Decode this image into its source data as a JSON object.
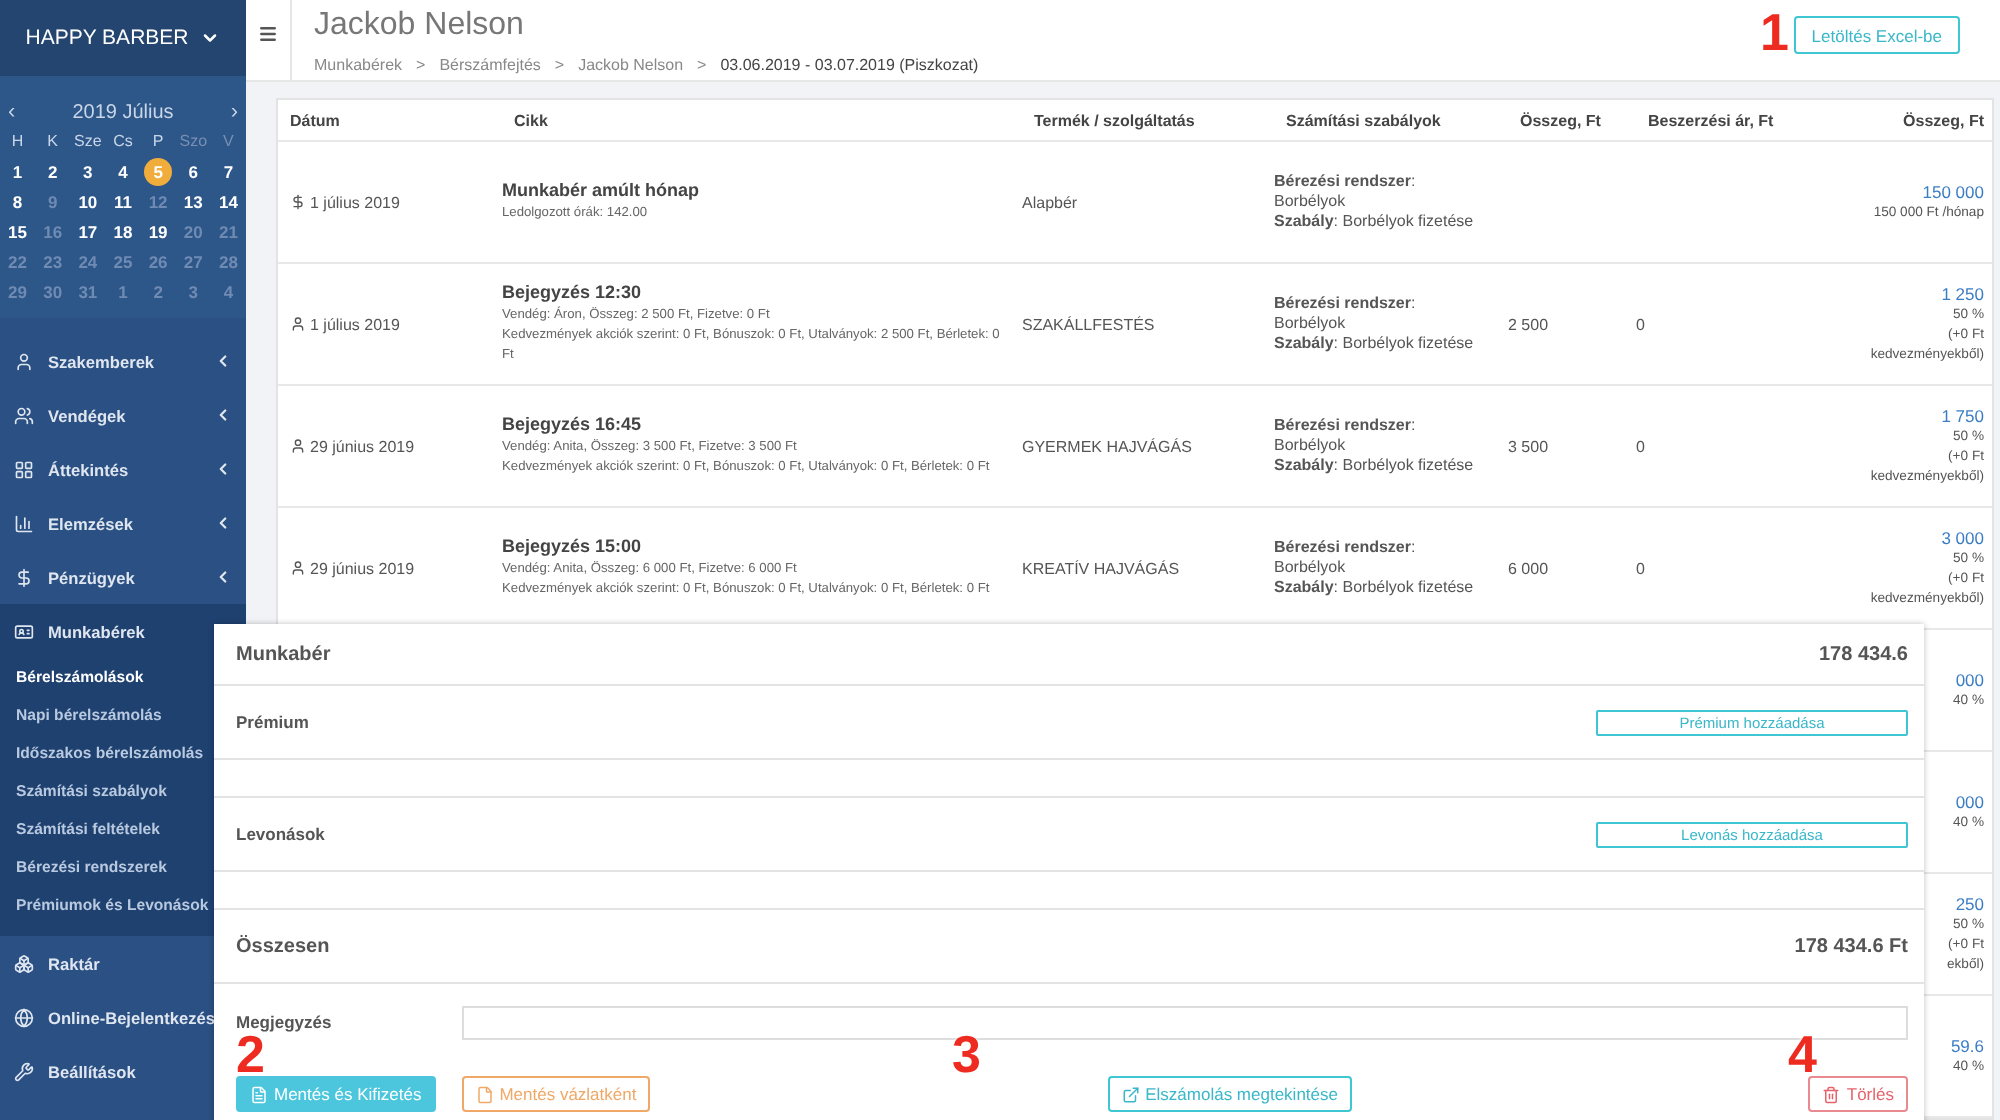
{
  "brand": {
    "name": "HAPPY BARBER"
  },
  "calendar": {
    "title": "2019 Július",
    "prev": "‹",
    "next": "›",
    "weekdays": [
      {
        "label": "H",
        "weekend": false
      },
      {
        "label": "K",
        "weekend": false
      },
      {
        "label": "Sze",
        "weekend": false
      },
      {
        "label": "Cs",
        "weekend": false
      },
      {
        "label": "P",
        "weekend": false
      },
      {
        "label": "Szo",
        "weekend": true
      },
      {
        "label": "V",
        "weekend": true
      }
    ],
    "days": [
      {
        "d": "1",
        "dim": false,
        "selected": false
      },
      {
        "d": "2",
        "dim": false,
        "selected": false
      },
      {
        "d": "3",
        "dim": false,
        "selected": false
      },
      {
        "d": "4",
        "dim": false,
        "selected": false
      },
      {
        "d": "5",
        "dim": false,
        "selected": true
      },
      {
        "d": "6",
        "dim": false,
        "selected": false
      },
      {
        "d": "7",
        "dim": false,
        "selected": false
      },
      {
        "d": "8",
        "dim": false,
        "selected": false
      },
      {
        "d": "9",
        "dim": true,
        "selected": false
      },
      {
        "d": "10",
        "dim": false,
        "selected": false
      },
      {
        "d": "11",
        "dim": false,
        "selected": false
      },
      {
        "d": "12",
        "dim": true,
        "selected": false
      },
      {
        "d": "13",
        "dim": false,
        "selected": false
      },
      {
        "d": "14",
        "dim": false,
        "selected": false
      },
      {
        "d": "15",
        "dim": false,
        "selected": false
      },
      {
        "d": "16",
        "dim": true,
        "selected": false
      },
      {
        "d": "17",
        "dim": false,
        "selected": false
      },
      {
        "d": "18",
        "dim": false,
        "selected": false
      },
      {
        "d": "19",
        "dim": false,
        "selected": false
      },
      {
        "d": "20",
        "dim": true,
        "selected": false
      },
      {
        "d": "21",
        "dim": true,
        "selected": false
      },
      {
        "d": "22",
        "dim": true,
        "selected": false
      },
      {
        "d": "23",
        "dim": true,
        "selected": false
      },
      {
        "d": "24",
        "dim": true,
        "selected": false
      },
      {
        "d": "25",
        "dim": true,
        "selected": false
      },
      {
        "d": "26",
        "dim": true,
        "selected": false
      },
      {
        "d": "27",
        "dim": true,
        "selected": false
      },
      {
        "d": "28",
        "dim": true,
        "selected": false
      },
      {
        "d": "29",
        "dim": true,
        "selected": false
      },
      {
        "d": "30",
        "dim": true,
        "selected": false
      },
      {
        "d": "31",
        "dim": true,
        "selected": false
      },
      {
        "d": "1",
        "dim": true,
        "selected": false
      },
      {
        "d": "2",
        "dim": true,
        "selected": false
      },
      {
        "d": "3",
        "dim": true,
        "selected": false
      },
      {
        "d": "4",
        "dim": true,
        "selected": false
      }
    ]
  },
  "sidebar": {
    "items": [
      {
        "label": "Szakemberek",
        "chevron": true
      },
      {
        "label": "Vendégek",
        "chevron": true
      },
      {
        "label": "Áttekintés",
        "chevron": true
      },
      {
        "label": "Elemzések",
        "chevron": true
      },
      {
        "label": "Pénzügyek",
        "chevron": true
      },
      {
        "label": "Munkabérek",
        "chevron": false,
        "expanded": true,
        "children": [
          {
            "label": "Bérelszámolások",
            "selected": true
          },
          {
            "label": "Napi bérelszámolás",
            "selected": false
          },
          {
            "label": "Időszakos bérelszámolás",
            "selected": false
          },
          {
            "label": "Számítási szabályok",
            "selected": false
          },
          {
            "label": "Számítási feltételek",
            "selected": false
          },
          {
            "label": "Bérezési rendszerek",
            "selected": false
          },
          {
            "label": "Prémiumok és Levonások",
            "selected": false
          }
        ]
      },
      {
        "label": "Raktár",
        "chevron": false
      },
      {
        "label": "Online-Bejelentkezés",
        "chevron": false
      },
      {
        "label": "Beállítások",
        "chevron": false
      }
    ]
  },
  "header": {
    "title": "Jackob Nelson",
    "breadcrumbs": [
      "Munkabérek",
      "Bérszámfejtés",
      "Jackob Nelson",
      "03.06.2019 - 03.07.2019 (Piszkozat)"
    ],
    "separator": ">",
    "export_button": "Letöltés Excel-be"
  },
  "table": {
    "columns": [
      "Dátum",
      "Cikk",
      "Termék / szolgáltatás",
      "Számítási szabályok",
      "Összeg, Ft",
      "Beszerzési ár, Ft",
      "Összeg, Ft"
    ],
    "rows": [
      {
        "kind": "payment",
        "date": "1 július 2019",
        "title": "Munkabér amúlt hónap",
        "details": [
          "Ledolgozott órák: 142.00"
        ],
        "product": "Alapbér",
        "rules": [
          "**Bérezési rendszer**:",
          "Borbélyok",
          "**Szabály**: Borbélyok fizetése"
        ],
        "amount": "",
        "cost": "",
        "total": "150 000",
        "total_notes": [
          "150 000 Ft /hónap"
        ]
      },
      {
        "kind": "booking",
        "date": "1 július 2019",
        "title": "Bejegyzés 12:30",
        "details": [
          "Vendég: Áron, Összeg: 2 500 Ft, Fizetve: 0 Ft",
          "Kedvezmények akciók szerint: 0 Ft, Bónuszok: 0 Ft, Utalványok: 2 500 Ft, Bérletek: 0 Ft"
        ],
        "product": "SZAKÁLLFESTÉS",
        "rules": [
          "**Bérezési rendszer**:",
          "Borbélyok",
          "**Szabály**: Borbélyok fizetése"
        ],
        "amount": "2 500",
        "cost": "0",
        "total": "1 250",
        "total_notes": [
          "50 %",
          "(+0 Ft",
          "kedvezményekből)"
        ]
      },
      {
        "kind": "booking",
        "date": "29 június 2019",
        "title": "Bejegyzés 16:45",
        "details": [
          "Vendég: Anita, Összeg: 3 500 Ft, Fizetve: 3 500 Ft",
          "Kedvezmények akciók szerint: 0 Ft, Bónuszok: 0 Ft, Utalványok: 0 Ft, Bérletek: 0 Ft"
        ],
        "product": "GYERMEK HAJVÁGÁS",
        "rules": [
          "**Bérezési rendszer**:",
          "Borbélyok",
          "**Szabály**: Borbélyok fizetése"
        ],
        "amount": "3 500",
        "cost": "0",
        "total": "1 750",
        "total_notes": [
          "50 %",
          "(+0 Ft",
          "kedvezményekből)"
        ]
      },
      {
        "kind": "booking",
        "date": "29 június 2019",
        "title": "Bejegyzés 15:00",
        "details": [
          "Vendég: Anita, Összeg: 6 000 Ft, Fizetve: 6 000 Ft",
          "Kedvezmények akciók szerint: 0 Ft, Bónuszok: 0 Ft, Utalványok: 0 Ft, Bérletek: 0 Ft"
        ],
        "product": "KREATÍV HAJVÁGÁS",
        "rules": [
          "**Bérezési rendszer**:",
          "Borbélyok",
          "**Szabály**: Borbélyok fizetése"
        ],
        "amount": "6 000",
        "cost": "0",
        "total": "3 000",
        "total_notes": [
          "50 %",
          "(+0 Ft",
          "kedvezményekből)"
        ]
      }
    ],
    "covered_rows": [
      {
        "total": "000",
        "total_notes": [
          "40 %"
        ]
      },
      {
        "total": "000",
        "total_notes": [
          "40 %"
        ]
      },
      {
        "total": "250",
        "total_notes": [
          "50 %",
          "(+0 Ft",
          "ekből)"
        ]
      },
      {
        "total": "59.6",
        "total_notes": [
          "40 %"
        ]
      }
    ]
  },
  "summary": {
    "salary_label": "Munkabér",
    "salary_value": "178 434.6",
    "bonus_label": "Prémium",
    "bonus_button": "Prémium hozzáadása",
    "deduction_label": "Levonások",
    "deduction_button": "Levonás hozzáadása",
    "total_label": "Összesen",
    "total_value": "178 434.6 Ft",
    "note_label": "Megjegyzés",
    "buttons": [
      {
        "kind": "primary",
        "label": "Mentés és Kifizetés"
      },
      {
        "kind": "draft",
        "label": "Mentés vázlatként"
      },
      {
        "kind": "view",
        "label": "Elszámolás megtekintése"
      },
      {
        "kind": "delete",
        "label": "Törlés"
      }
    ]
  },
  "annotations": [
    "1",
    "2",
    "3",
    "4"
  ]
}
